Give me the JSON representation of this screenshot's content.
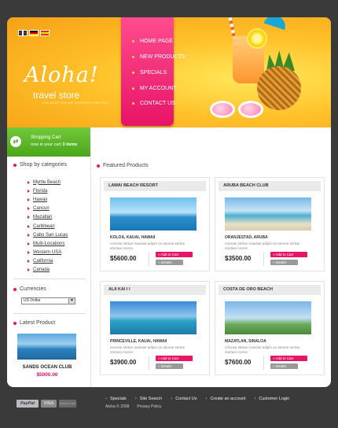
{
  "header": {
    "logo_script": "Aloha!",
    "logo_subtitle": "travel store",
    "logo_tagline": "THE BEST ONLINE SERVICES FOR YOU",
    "languages": [
      "English",
      "Deutsch",
      "Español"
    ]
  },
  "nav": {
    "items": [
      "HOME PAGE",
      "NEW PRODUCTS",
      "SPECIALS",
      "MY ACCOUNT",
      "CONTACT US"
    ]
  },
  "cart": {
    "title": "Shopping Cart",
    "text_prefix": "now in your cart",
    "count": "3",
    "unit": "items"
  },
  "sidebar": {
    "categories_title": "Shop by categories",
    "categories": [
      "Myrtle Beach",
      "Florida",
      "Hawaii",
      "Cancun",
      "Mazatlan",
      "Caribbean",
      "Cabo San Lucas",
      "Multi-Locations",
      "Western USA",
      "California",
      "Canada"
    ],
    "currencies_title": "Currencies",
    "currency_selected": "US Dollar",
    "latest_title": "Latest Product",
    "latest_name": "SANDS OCEAN CLUB",
    "latest_price": "$5000.00"
  },
  "main": {
    "featured_title": "Featured Products",
    "add_to_cart_label": "Add to Cart",
    "details_label": "Details",
    "products": [
      {
        "title": "LAWAI BEACH RESORT",
        "location": "KOLOA, KAUAI, HAWAII",
        "desc": "morose stetue maesas adipis on asume sertas elortasi mores",
        "price": "$5600.00"
      },
      {
        "title": "ARUBA BEACH CLUB",
        "location": "ORANJESTAD, ARUBA",
        "desc": "morose stetue maesas adipis on asume sertas elortasi mores",
        "price": "$3500.00"
      },
      {
        "title": "ALII KAI I I",
        "location": "PRINCEVILLE, KAUAI, HAWAII",
        "desc": "morose stetue maesas adipis on asume sertas elortasi mores",
        "price": "$3900.00"
      },
      {
        "title": "COSTA DE ORO BEACH",
        "location": "MAZATLAN, SINALOA",
        "desc": "morose stetue maesas adipis on asume sertas elortasi mores",
        "price": "$7600.00"
      }
    ]
  },
  "footer": {
    "links": [
      "Specials",
      "Site Search",
      "Contact Us",
      "Create an account",
      "Customer Login"
    ],
    "copyright": "Aloha © 2008",
    "privacy": "Privacy Policy",
    "payments": [
      "PayPal",
      "VISA",
      "MasterCard"
    ]
  }
}
